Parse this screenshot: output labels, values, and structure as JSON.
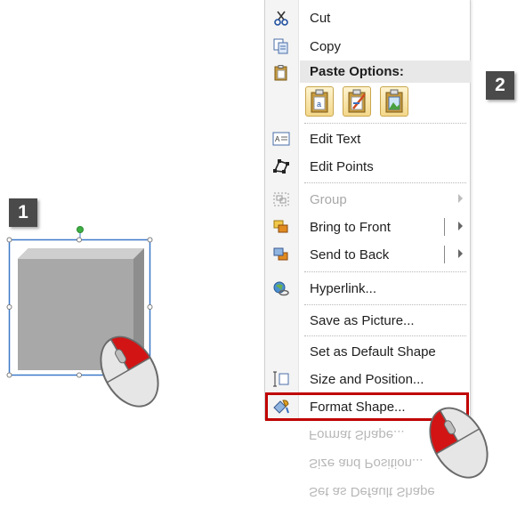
{
  "steps": {
    "step1": "1",
    "step2": "2"
  },
  "context_menu": {
    "items": [
      {
        "label": "Cut",
        "icon": "scissors-icon",
        "disabled": false
      },
      {
        "label": "Copy",
        "icon": "copy-icon",
        "disabled": false
      },
      {
        "label": "Paste Options:",
        "icon": "clipboard-icon",
        "disabled": false
      },
      {
        "label": "Edit Text",
        "icon": "edit-text-icon",
        "disabled": false
      },
      {
        "label": "Edit Points",
        "icon": "edit-points-icon",
        "disabled": false
      },
      {
        "label": "Group",
        "icon": "group-icon",
        "disabled": true
      },
      {
        "label": "Bring to Front",
        "icon": "bring-to-front-icon",
        "disabled": false
      },
      {
        "label": "Send to Back",
        "icon": "send-to-back-icon",
        "disabled": false
      },
      {
        "label": "Hyperlink...",
        "icon": "hyperlink-icon",
        "disabled": false
      },
      {
        "label": "Save as Picture...",
        "icon": "",
        "disabled": false
      },
      {
        "label": "Set as Default Shape",
        "icon": "",
        "disabled": false
      },
      {
        "label": "Size and Position...",
        "icon": "size-position-icon",
        "disabled": false
      },
      {
        "label": "Format Shape...",
        "icon": "format-shape-icon",
        "disabled": false
      }
    ],
    "paste_buttons": [
      "paste-use-destination-theme-icon",
      "paste-keep-source-formatting-icon",
      "paste-picture-icon"
    ]
  },
  "reflection": {
    "lines": [
      "Format Shape...",
      "Size and Position...",
      "Set as Default Shape"
    ]
  },
  "colors": {
    "highlight": "#c00000",
    "badge": "#4a4a4a",
    "shape_face": "#a6a6a6",
    "selection": "#3c78c8",
    "rotate_handle": "#3cb043"
  }
}
